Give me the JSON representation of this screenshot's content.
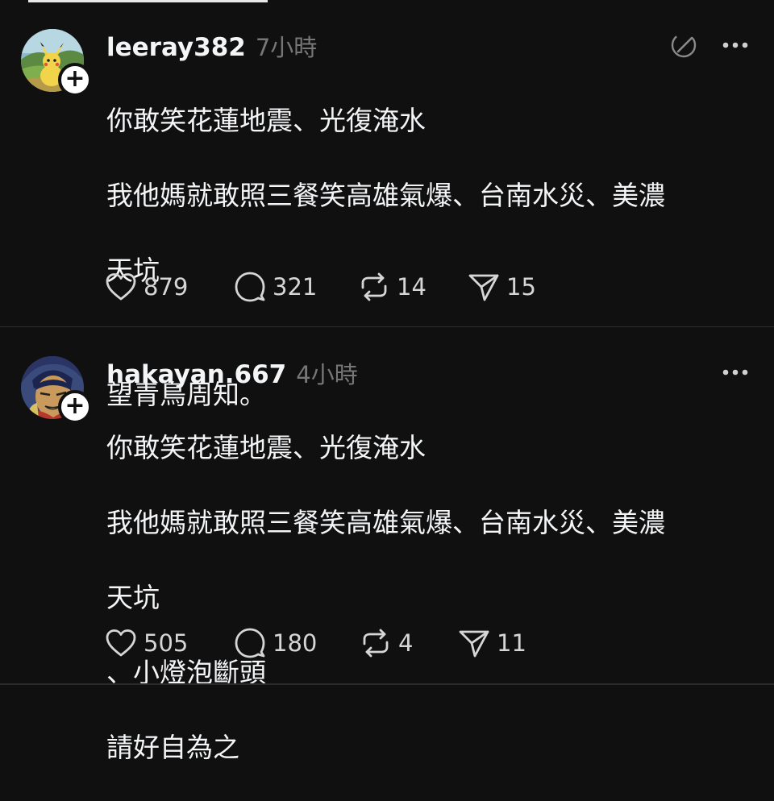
{
  "posts": [
    {
      "username": "leeray382",
      "time": "7小時",
      "lines": [
        "你敢笑花蓮地震、光復淹水",
        "我他媽就敢照三餐笑高雄氣爆、台南水災、美濃",
        "天坑"
      ],
      "lines2": [
        "望青鳥周知。"
      ],
      "likes": "879",
      "replies": "321",
      "reposts": "14",
      "shares": "15",
      "avatar_icon": "pikachu-landscape-avatar",
      "has_edit_icon": true
    },
    {
      "username": "hakayan.667",
      "time": "4小時",
      "lines": [
        "你敢笑花蓮地震、光復淹水",
        "我他媽就敢照三餐笑高雄氣爆、台南水災、美濃",
        "天坑",
        "、小燈泡斷頭",
        "請好自為之"
      ],
      "likes": "505",
      "replies": "180",
      "reposts": "4",
      "shares": "11",
      "avatar_icon": "anime-character-avatar",
      "has_edit_icon": false
    }
  ],
  "follow_badge": "+",
  "colors": {
    "background": "#101010",
    "text": "#f3f5f7",
    "muted": "#777777"
  }
}
